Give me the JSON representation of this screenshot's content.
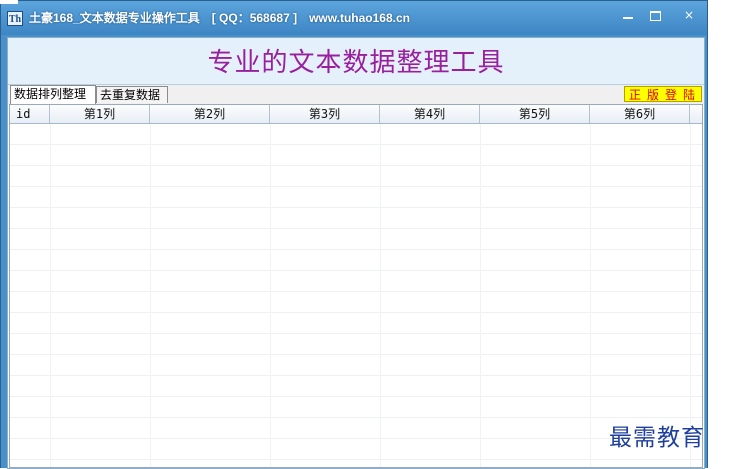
{
  "window": {
    "app_icon_text": "Th",
    "title": "土豪168_文本数据专业操作工具　[ QQ：568687 ]　www.tuhao168.cn",
    "minimize_symbol": "–",
    "maximize_symbol": "□",
    "close_symbol": "×"
  },
  "banner": {
    "title": "专业的文本数据整理工具",
    "title_color": "#9a1f9e"
  },
  "tabs": [
    {
      "label": "数据排列整理",
      "active": true
    },
    {
      "label": "去重复数据",
      "active": false
    }
  ],
  "register_button": {
    "label": "正版登陆",
    "background": "#ffff00",
    "text_color": "#e00000"
  },
  "grid": {
    "columns": [
      "id",
      "第1列",
      "第2列",
      "第3列",
      "第4列",
      "第5列",
      "第6列"
    ],
    "rows": []
  },
  "watermark": {
    "text": "最需教育",
    "color": "#1f3f9c"
  },
  "icons": {
    "app": "app-logo-icon",
    "minimize": "minimize-icon",
    "maximize": "maximize-icon",
    "close": "close-icon"
  }
}
